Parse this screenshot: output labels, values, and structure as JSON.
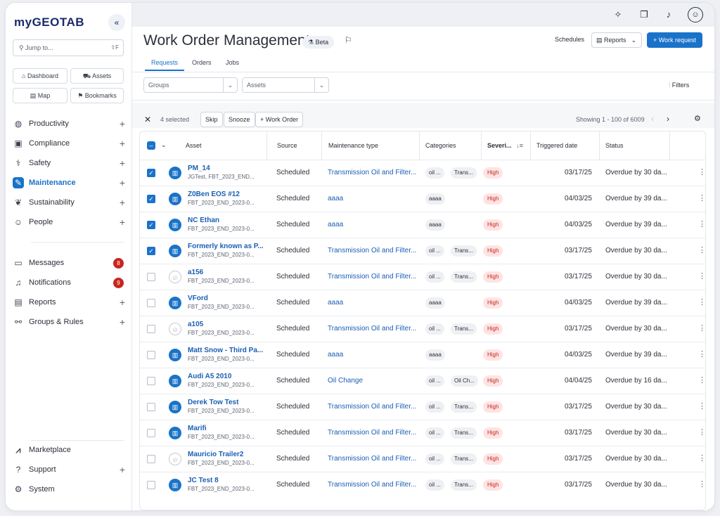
{
  "sidebar": {
    "logo": "myGEOTAB",
    "collapse": "«",
    "jump": {
      "placeholder": "Jump to...",
      "shortcut": "⇧F"
    },
    "quick": [
      "Dashboard",
      "Assets",
      "Map",
      "Bookmarks"
    ],
    "nav": [
      {
        "label": "Productivity",
        "icon": "globe-icon"
      },
      {
        "label": "Compliance",
        "icon": "clipboard-icon"
      },
      {
        "label": "Safety",
        "icon": "shield-icon"
      },
      {
        "label": "Maintenance",
        "icon": "wrench-icon"
      },
      {
        "label": "Sustainability",
        "icon": "leaf-icon"
      },
      {
        "label": "People",
        "icon": "people-icon"
      },
      {
        "label": "Messages",
        "badge": "8"
      },
      {
        "label": "Notifications",
        "badge": "9"
      },
      {
        "label": "Reports"
      },
      {
        "label": "Groups & Rules"
      },
      {
        "label": "Marketplace"
      },
      {
        "label": "Support"
      },
      {
        "label": "System"
      }
    ]
  },
  "header": {
    "title": "Work Order Management",
    "beta": "Beta",
    "schedules": "Schedules",
    "reports": "Reports",
    "work_request": "+ Work request",
    "tabs": [
      "Requests",
      "Orders",
      "Jobs"
    ]
  },
  "filters": {
    "groups": "Groups",
    "assets": "Assets",
    "filters_label": "Filters"
  },
  "toolbar": {
    "selected": "4 selected",
    "skip": "Skip",
    "snooze": "Snooze",
    "work_order": "+ Work Order",
    "showing": "Showing 1 - 100 of 6009"
  },
  "table": {
    "columns": [
      "Asset",
      "Source",
      "Maintenance type",
      "Categories",
      "Severi...",
      "Triggered date",
      "Status"
    ],
    "rows": [
      {
        "checked": true,
        "icon": "on",
        "name": "PM_14",
        "sub": "JGTest, FBT_2023_END...",
        "source": "Scheduled",
        "type": "Transmission Oil and Filter...",
        "cats": [
          "oil ...",
          "Trans..."
        ],
        "sev": "High",
        "date": "03/17/25",
        "status": "Overdue by 30 da..."
      },
      {
        "checked": true,
        "icon": "on",
        "name": "Z0Ben EOS #12",
        "sub": "FBT_2023_END_2023-0...",
        "source": "Scheduled",
        "type": "aaaa",
        "cats": [
          "aaaa"
        ],
        "sev": "High",
        "date": "04/03/25",
        "status": "Overdue by 39 da..."
      },
      {
        "checked": true,
        "icon": "on",
        "name": "NC Ethan",
        "sub": "FBT_2023_END_2023-0...",
        "source": "Scheduled",
        "type": "aaaa",
        "cats": [
          "aaaa"
        ],
        "sev": "High",
        "date": "04/03/25",
        "status": "Overdue by 39 da..."
      },
      {
        "checked": true,
        "icon": "on",
        "name": "Formerly known as P...",
        "sub": "FBT_2023_END_2023-0...",
        "source": "Scheduled",
        "type": "Transmission Oil and Filter...",
        "cats": [
          "oil ...",
          "Trans..."
        ],
        "sev": "High",
        "date": "03/17/25",
        "status": "Overdue by 30 da..."
      },
      {
        "checked": false,
        "icon": "off",
        "name": "a156",
        "sub": "FBT_2023_END_2023-0...",
        "source": "Scheduled",
        "type": "Transmission Oil and Filter...",
        "cats": [
          "oil ...",
          "Trans..."
        ],
        "sev": "High",
        "date": "03/17/25",
        "status": "Overdue by 30 da..."
      },
      {
        "checked": false,
        "icon": "on",
        "name": "VFord",
        "sub": "FBT_2023_END_2023-0...",
        "source": "Scheduled",
        "type": "aaaa",
        "cats": [
          "aaaa"
        ],
        "sev": "High",
        "date": "04/03/25",
        "status": "Overdue by 39 da..."
      },
      {
        "checked": false,
        "icon": "off",
        "name": "a105",
        "sub": "FBT_2023_END_2023-0...",
        "source": "Scheduled",
        "type": "Transmission Oil and Filter...",
        "cats": [
          "oil ...",
          "Trans..."
        ],
        "sev": "High",
        "date": "03/17/25",
        "status": "Overdue by 30 da..."
      },
      {
        "checked": false,
        "icon": "on",
        "name": "Matt Snow - Third Pa...",
        "sub": "FBT_2023_END_2023-0...",
        "source": "Scheduled",
        "type": "aaaa",
        "cats": [
          "aaaa"
        ],
        "sev": "High",
        "date": "04/03/25",
        "status": "Overdue by 39 da..."
      },
      {
        "checked": false,
        "icon": "on",
        "name": "Audi A5 2010",
        "sub": "FBT_2023_END_2023-0...",
        "source": "Scheduled",
        "type": "Oil Change",
        "cats": [
          "oil ...",
          "Oil Ch..."
        ],
        "sev": "High",
        "date": "04/04/25",
        "status": "Overdue by 16 da..."
      },
      {
        "checked": false,
        "icon": "on",
        "name": "Derek Tow Test",
        "sub": "FBT_2023_END_2023-0...",
        "source": "Scheduled",
        "type": "Transmission Oil and Filter...",
        "cats": [
          "oil ...",
          "Trans..."
        ],
        "sev": "High",
        "date": "03/17/25",
        "status": "Overdue by 30 da..."
      },
      {
        "checked": false,
        "icon": "on",
        "name": "Marifi",
        "sub": "FBT_2023_END_2023-0...",
        "source": "Scheduled",
        "type": "Transmission Oil and Filter...",
        "cats": [
          "oil ...",
          "Trans..."
        ],
        "sev": "High",
        "date": "03/17/25",
        "status": "Overdue by 30 da..."
      },
      {
        "checked": false,
        "icon": "off",
        "name": "Mauricio Trailer2",
        "sub": "FBT_2023_END_2023-0...",
        "source": "Scheduled",
        "type": "Transmission Oil and Filter...",
        "cats": [
          "oil ...",
          "Trans..."
        ],
        "sev": "High",
        "date": "03/17/25",
        "status": "Overdue by 30 da..."
      },
      {
        "checked": false,
        "icon": "on",
        "name": "JC Test 8",
        "sub": "FBT_2023_END_2023-0...",
        "source": "Scheduled",
        "type": "Transmission Oil and Filter...",
        "cats": [
          "oil ...",
          "Trans..."
        ],
        "sev": "High",
        "date": "03/17/25",
        "status": "Overdue by 30 da..."
      }
    ]
  },
  "colors": {
    "accent": "#1a73c9",
    "badge": "#c8261f",
    "severity_bg": "#fde4e3"
  }
}
